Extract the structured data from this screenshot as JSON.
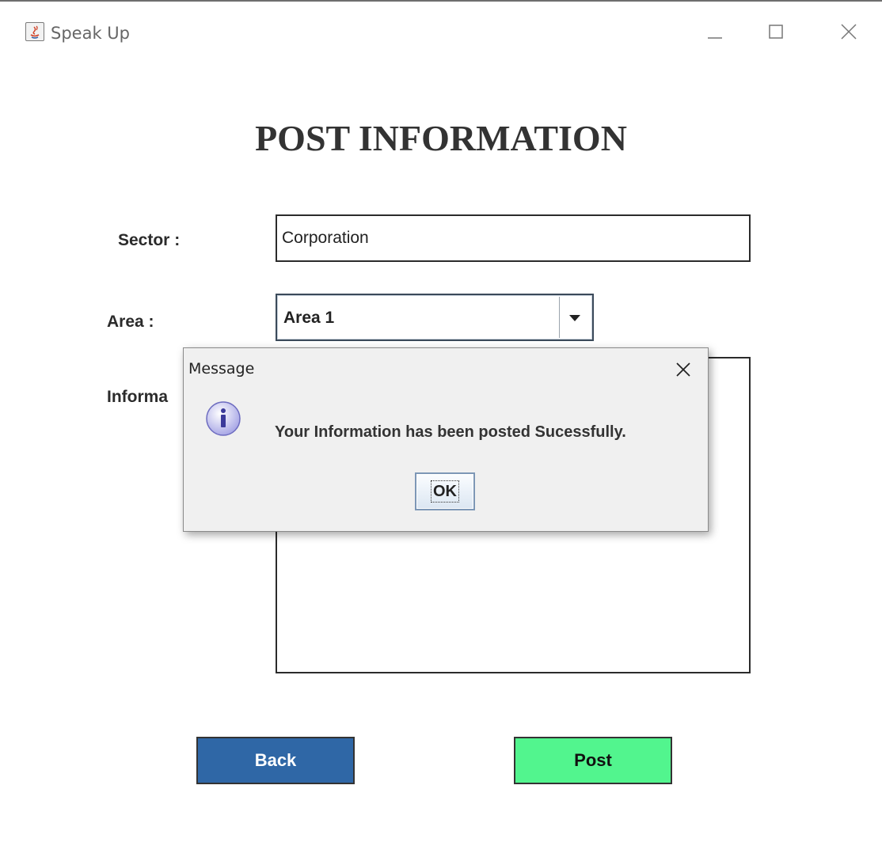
{
  "window": {
    "title": "Speak Up",
    "icon": "java-app-icon",
    "controls": [
      "minimize-icon",
      "maximize-icon",
      "close-icon"
    ]
  },
  "form": {
    "heading": "POST INFORMATION",
    "sector": {
      "label": "Sector :",
      "value": "Corporation"
    },
    "area": {
      "label": "Area :",
      "selected": "Area 1"
    },
    "information": {
      "label": "Informa",
      "value": ""
    }
  },
  "buttons": {
    "back": "Back",
    "post": "Post"
  },
  "dialog": {
    "title": "Message",
    "icon": "info-icon",
    "message": "Your Information has been posted Sucessfully.",
    "ok": "OK"
  },
  "colors": {
    "back_button": "#2f67a6",
    "post_button": "#52f58e",
    "dialog_bg": "#f0f0f0"
  }
}
